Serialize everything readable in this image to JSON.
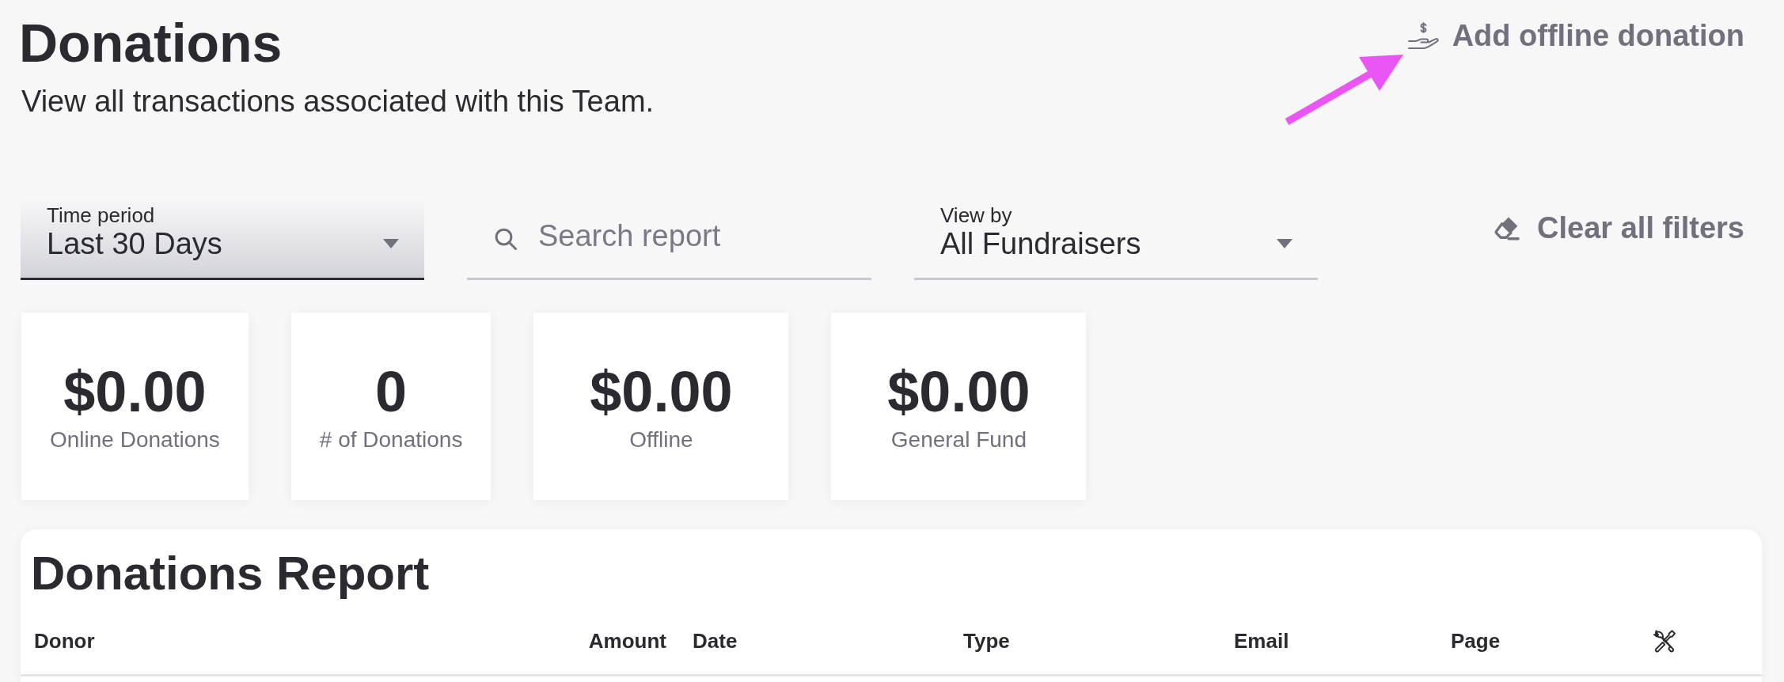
{
  "header": {
    "title": "Donations",
    "subtitle": "View all transactions associated with this Team.",
    "action": {
      "label": "Add offline donation"
    }
  },
  "filters": [
    {
      "kind": "select",
      "label": "Time period",
      "value": "Last 30 Days",
      "active": true
    },
    {
      "kind": "search",
      "placeholder": "Search report",
      "active": false
    },
    {
      "kind": "select",
      "label": "View by",
      "value": "All Fundraisers",
      "active": false
    }
  ],
  "clear_filters": {
    "label": "Clear all filters"
  },
  "stats": [
    {
      "value": "$0.00",
      "label": "Online Donations"
    },
    {
      "value": "0",
      "label": "# of Donations"
    },
    {
      "value": "$0.00",
      "label": "Offline"
    },
    {
      "value": "$0.00",
      "label": "General Fund"
    }
  ],
  "report": {
    "title": "Donations Report",
    "columns": [
      "Donor",
      "Amount",
      "Date",
      "Type",
      "Email",
      "Page"
    ]
  }
}
